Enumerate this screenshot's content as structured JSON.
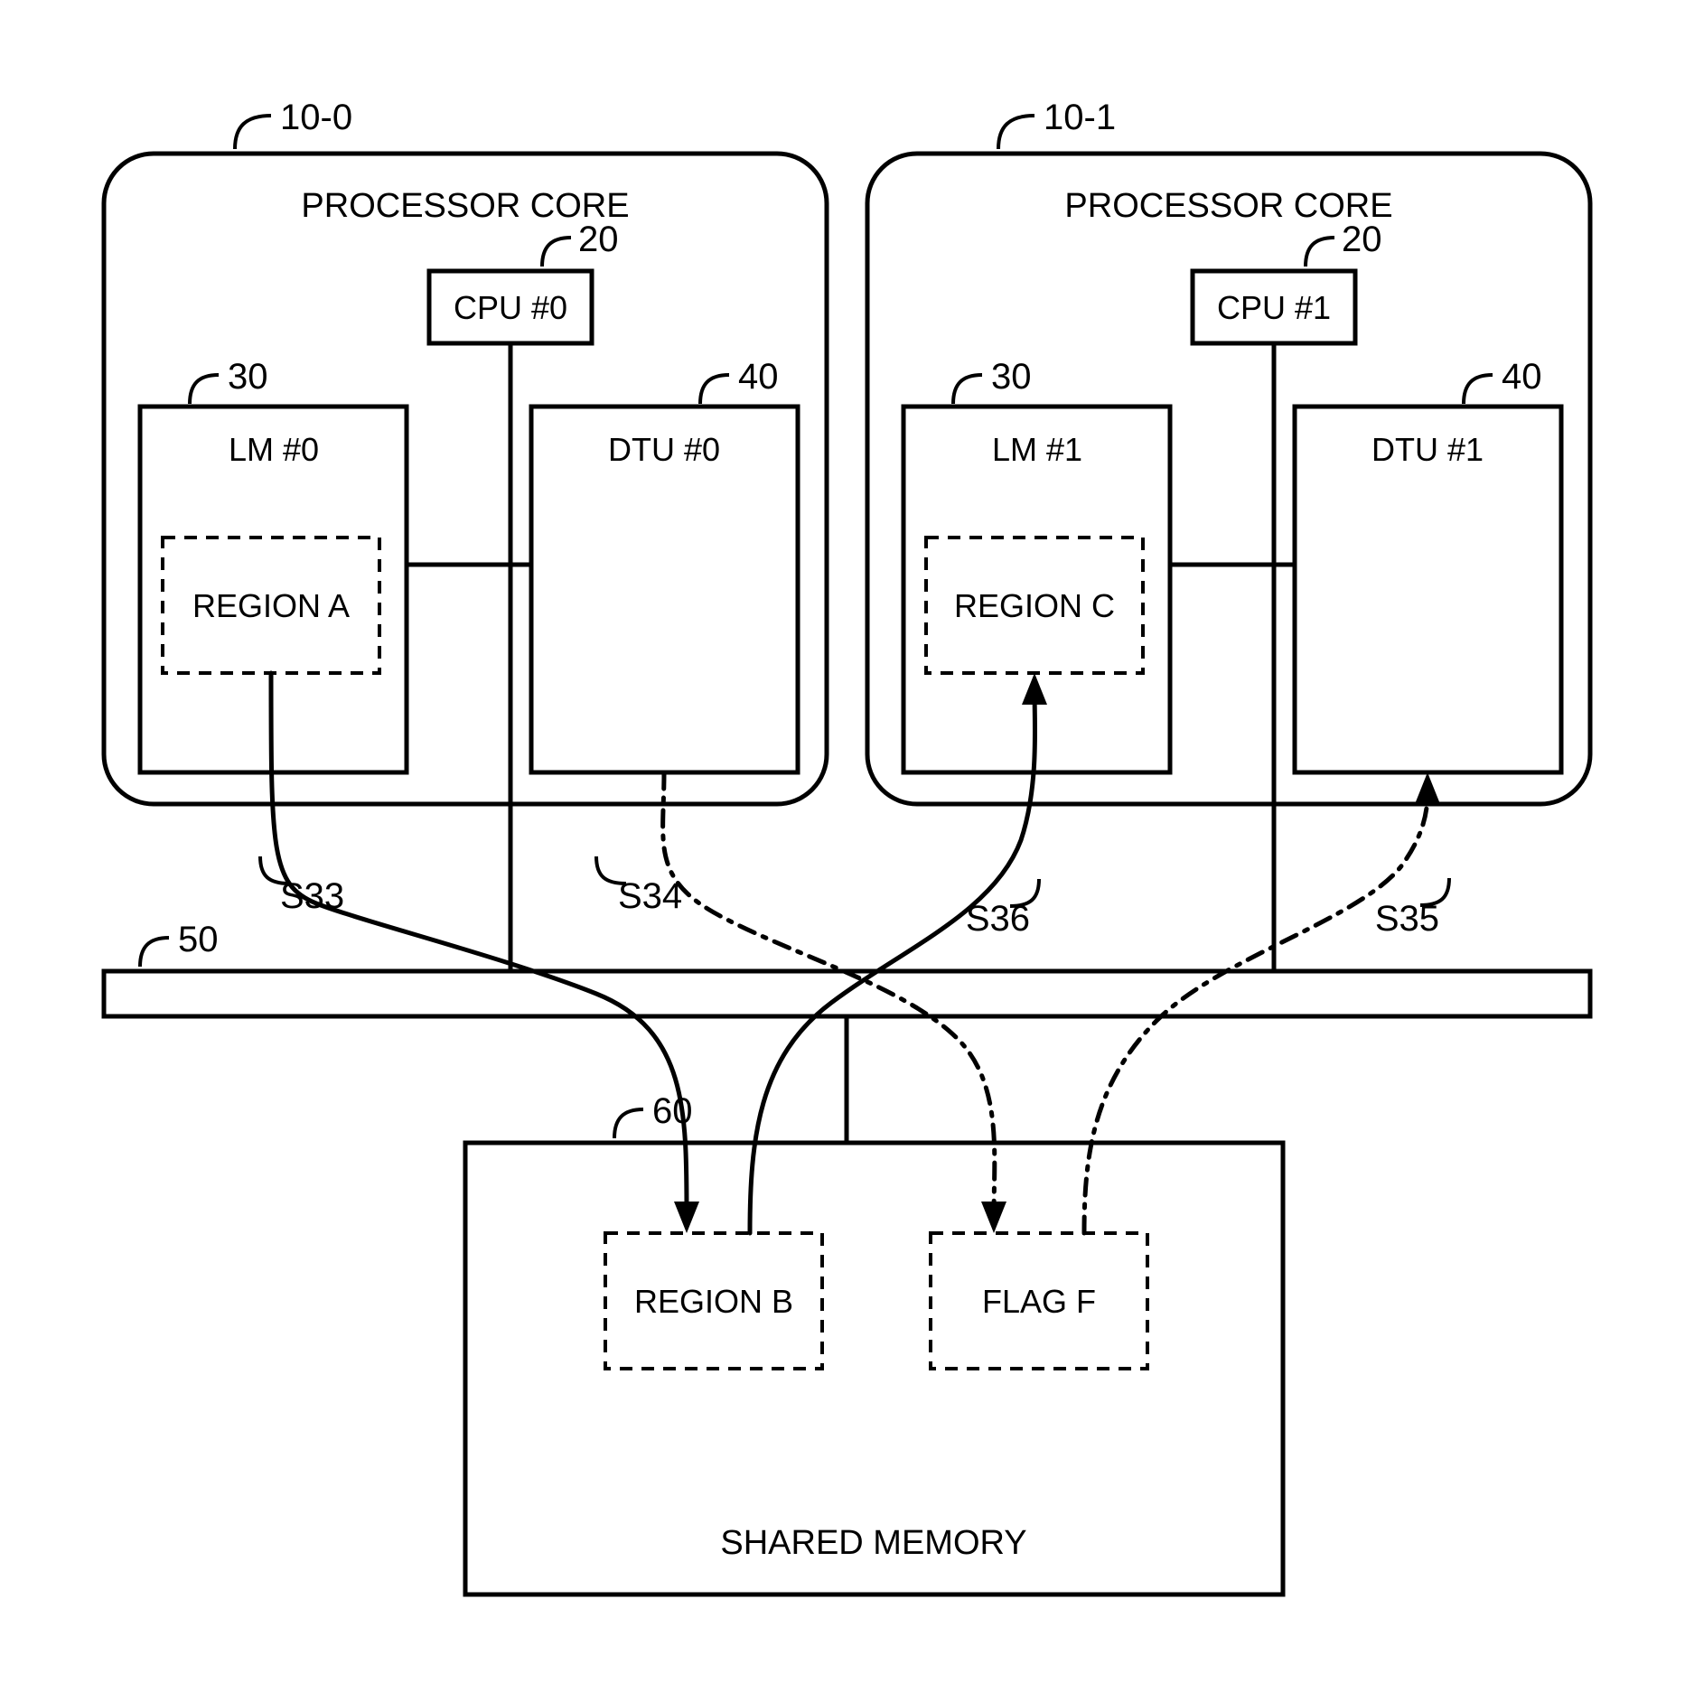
{
  "core0": {
    "ref": "10-0",
    "title": "PROCESSOR CORE",
    "cpu_ref": "20",
    "cpu_label": "CPU #0",
    "lm_ref": "30",
    "lm_label": "LM #0",
    "dtu_ref": "40",
    "dtu_label": "DTU #0",
    "region": "REGION A"
  },
  "core1": {
    "ref": "10-1",
    "title": "PROCESSOR CORE",
    "cpu_ref": "20",
    "cpu_label": "CPU #1",
    "lm_ref": "30",
    "lm_label": "LM #1",
    "dtu_ref": "40",
    "dtu_label": "DTU #1",
    "region": "REGION C"
  },
  "bus_ref": "50",
  "mem": {
    "ref": "60",
    "title": "SHARED MEMORY",
    "region": "REGION B",
    "flag": "FLAG F"
  },
  "steps": {
    "s33": "S33",
    "s34": "S34",
    "s35": "S35",
    "s36": "S36"
  }
}
